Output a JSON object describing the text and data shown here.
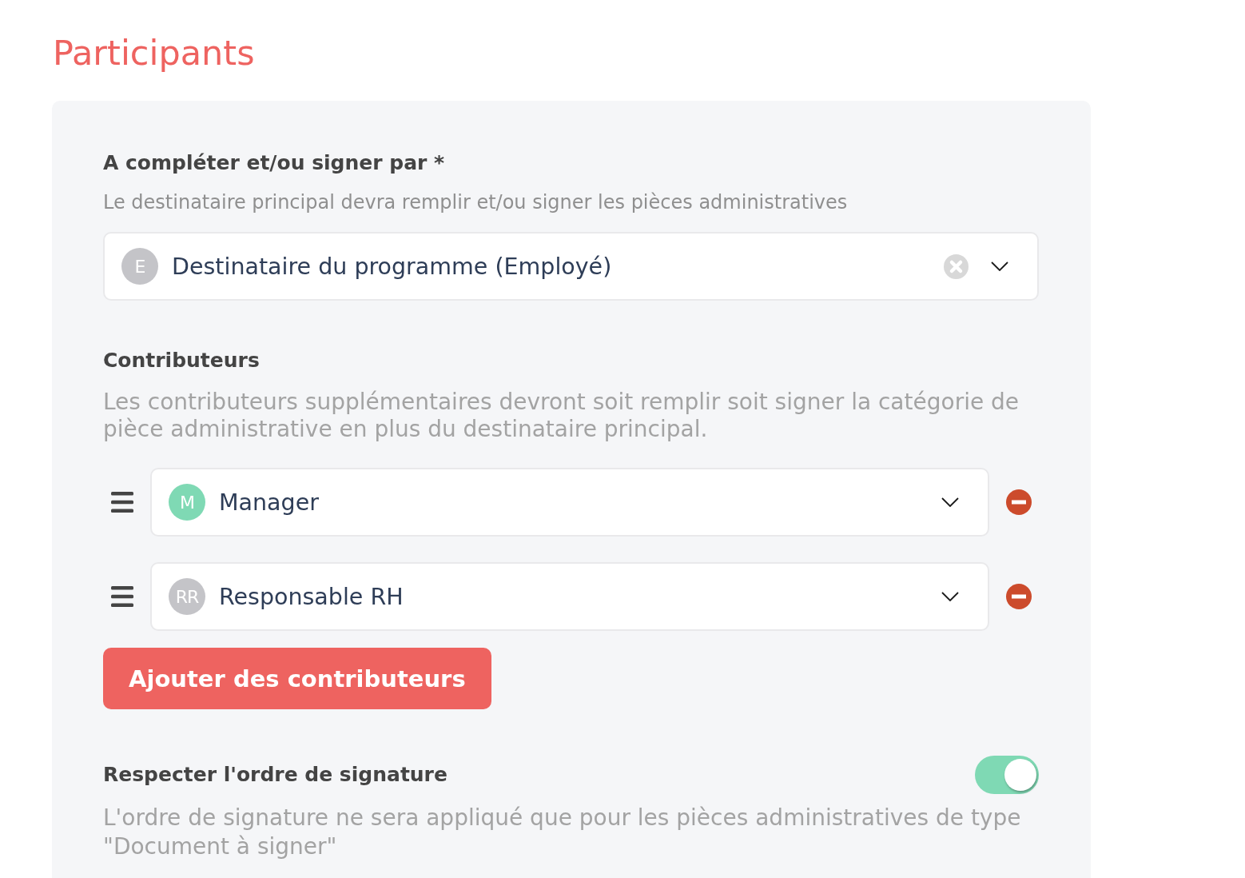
{
  "page_title": "Participants",
  "signer": {
    "label": "A compléter et/ou signer par *",
    "description": "Le destinataire principal devra remplir et/ou signer les pièces administratives",
    "select": {
      "initials": "E",
      "value": "Destinataire du programme (Employé)",
      "clearable": true
    }
  },
  "contributors": {
    "label": "Contributeurs",
    "description": "Les contributeurs supplémentaires devront soit remplir soit signer la catégorie de pièce administrative en plus du destinataire principal.",
    "items": [
      {
        "initials": "M",
        "value": "Manager",
        "color": "#7fd9b4",
        "clearable": false
      },
      {
        "initials": "RR",
        "value": "Responsable RH",
        "color": "#c4c4c8",
        "clearable": false
      }
    ],
    "add_button": "Ajouter des contributeurs"
  },
  "signature_order": {
    "label": "Respecter l'ordre de signature",
    "on": true,
    "description": "L'ordre de signature ne sera appliqué que pour les pièces administratives de type \"Document à signer\""
  }
}
